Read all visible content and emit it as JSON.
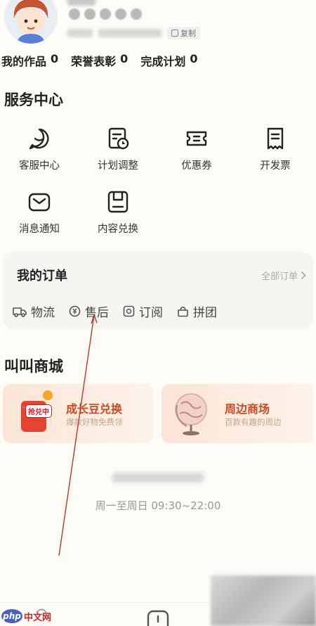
{
  "profile": {
    "copy_label": "复制"
  },
  "stats": [
    {
      "label": "我的作品",
      "value": "0"
    },
    {
      "label": "荣誉表彰",
      "value": "0"
    },
    {
      "label": "完成计划",
      "value": "0"
    }
  ],
  "services": {
    "title": "服务中心",
    "items": [
      {
        "label": "客服中心",
        "icon": "chat-bubble-icon"
      },
      {
        "label": "计划调整",
        "icon": "plan-adjust-icon"
      },
      {
        "label": "优惠券",
        "icon": "coupon-icon"
      },
      {
        "label": "开发票",
        "icon": "invoice-icon"
      },
      {
        "label": "消息通知",
        "icon": "envelope-icon"
      },
      {
        "label": "内容兑换",
        "icon": "content-redeem-icon"
      }
    ]
  },
  "orders": {
    "title": "我的订单",
    "all_label": "全部订单",
    "tabs": [
      {
        "label": "物流",
        "icon": "truck-icon"
      },
      {
        "label": "售后",
        "icon": "after-sale-icon"
      },
      {
        "label": "订阅",
        "icon": "subscribe-icon"
      },
      {
        "label": "拼团",
        "icon": "group-buy-icon"
      }
    ]
  },
  "mall": {
    "title": "叫叫商城",
    "cards": [
      {
        "title": "成长豆兑换",
        "subtitle": "爆款好物免费领",
        "tag": "抢兑中"
      },
      {
        "title": "周边商场",
        "subtitle": "百款有趣的周边"
      }
    ]
  },
  "footer": {
    "hours": "周一至周日 09:30~22:00"
  },
  "watermark": {
    "logo": "php",
    "text": "中文网"
  },
  "colors": {
    "accent": "#d0481e",
    "background": "#fdfbf6",
    "annotation_line": "#b23a2e"
  }
}
